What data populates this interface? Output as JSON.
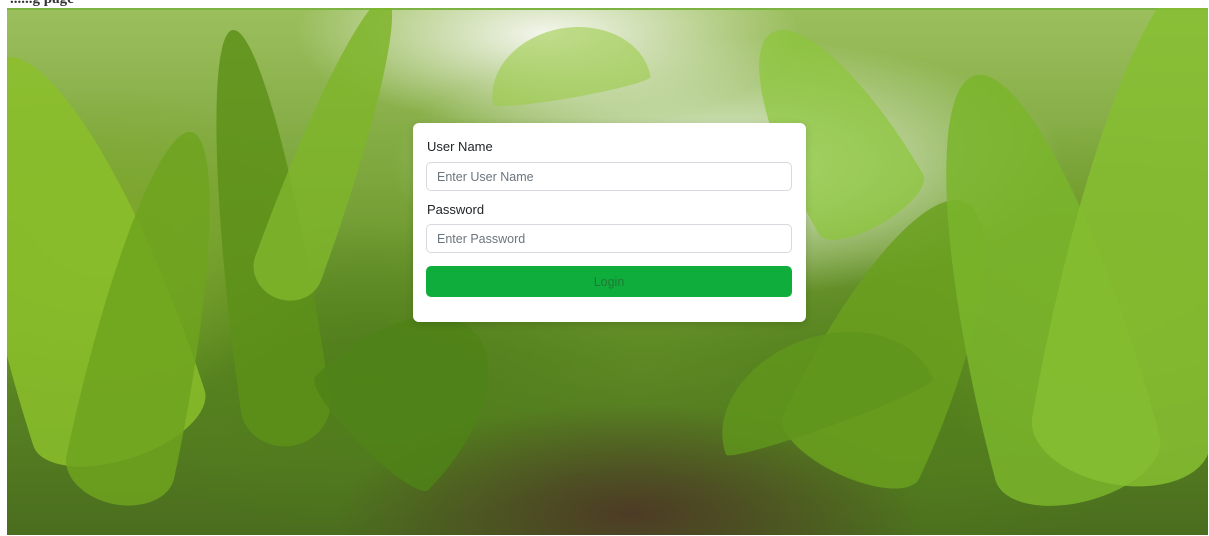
{
  "page": {
    "crop_text": "......g page",
    "background_description": "cornfield"
  },
  "login_form": {
    "username_label": "User Name",
    "username_placeholder": "Enter User Name",
    "username_value": "",
    "password_label": "Password",
    "password_placeholder": "Enter Password",
    "password_value": "",
    "login_label": "Login"
  },
  "colors": {
    "primary_button": "#0fae3c",
    "button_text": "#1e7a35",
    "card_background": "#ffffff",
    "page_border": "#7cb342"
  }
}
